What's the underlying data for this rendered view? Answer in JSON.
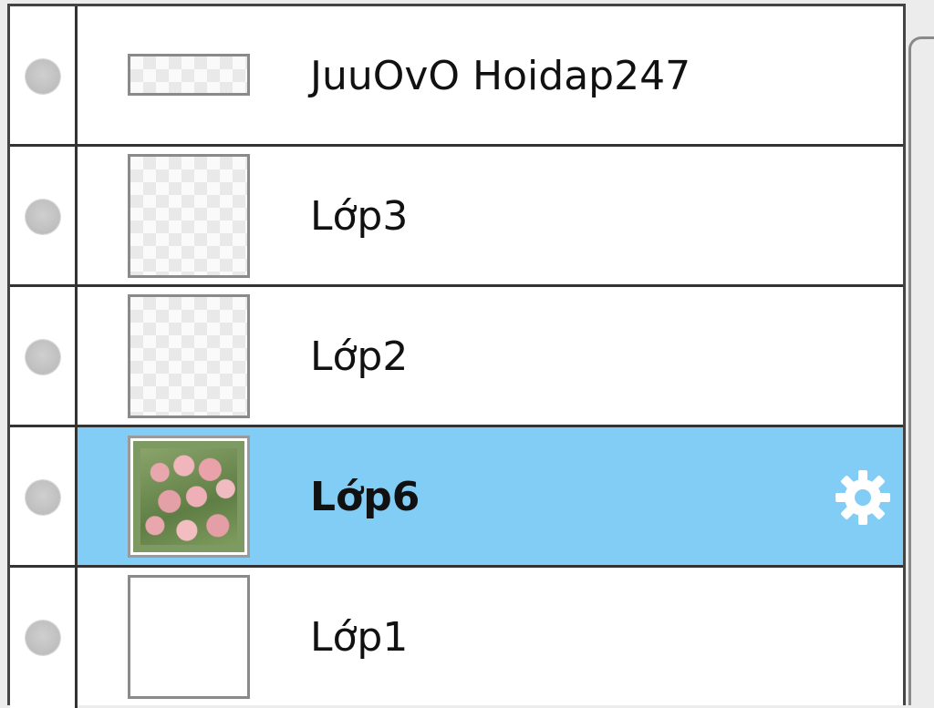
{
  "layers": [
    {
      "name": "JuuOvO Hoidap247",
      "thumbnail": "transparent-wide",
      "selected": false,
      "visibility": "dot"
    },
    {
      "name": "Lớp3",
      "thumbnail": "transparent",
      "selected": false,
      "visibility": "dot"
    },
    {
      "name": "Lớp2",
      "thumbnail": "transparent",
      "selected": false,
      "visibility": "dot"
    },
    {
      "name": "Lớp6",
      "thumbnail": "photo-flowers",
      "selected": true,
      "visibility": "dot",
      "settings_icon": "gear-icon"
    },
    {
      "name": "Lớp1",
      "thumbnail": "blank-white",
      "selected": false,
      "visibility": "dot"
    }
  ],
  "colors": {
    "selected_row": "#82cdf5",
    "row_border": "#333333",
    "gear_icon": "#ffffff"
  }
}
